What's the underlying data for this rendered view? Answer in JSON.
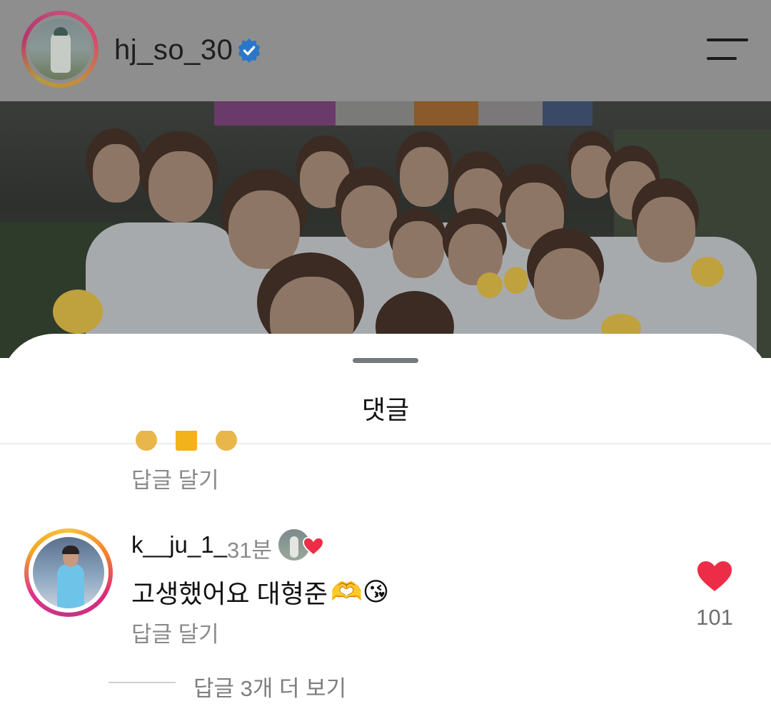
{
  "header": {
    "username": "hj_so_30",
    "verified_icon": "verified-badge-icon",
    "menu_icon": "hamburger-menu-icon"
  },
  "sheet": {
    "title": "댓글"
  },
  "previous_comment": {
    "reply_label": "답글 달기"
  },
  "comment": {
    "username": "k__ju_1_",
    "time": "31분",
    "text": "고생했어요 대형준",
    "emojis": "🫶😘",
    "reply_label": "답글 달기",
    "like_count": "101",
    "liked": true
  },
  "replies": {
    "view_more_label": "답글 3개 더 보기"
  },
  "colors": {
    "heart": "#ed2d47",
    "verified": "#2a77c9",
    "secondary_text": "#8a8a8a"
  }
}
